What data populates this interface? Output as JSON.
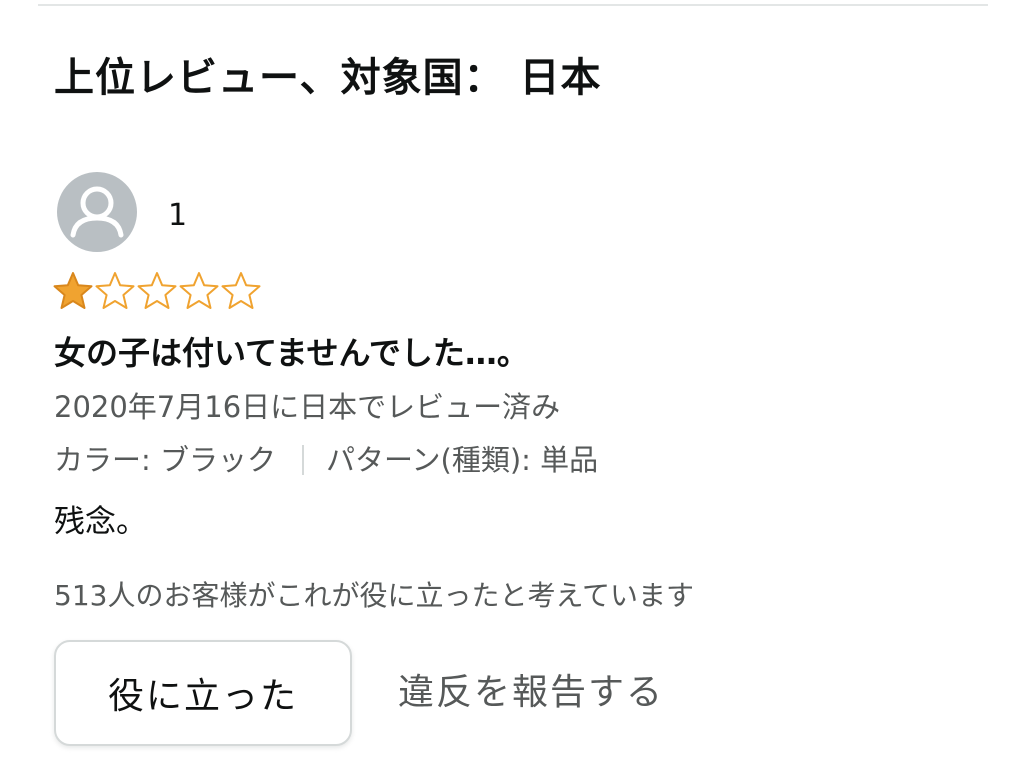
{
  "section": {
    "title": "上位レビュー、対象国： 日本"
  },
  "review": {
    "reviewer_name": "1",
    "avatar_icon": "user-silhouette-icon",
    "rating": 1,
    "rating_max": 5,
    "star_color": "#f0a330",
    "title": "女の子は付いてませんでした…。",
    "date_line": "2020年7月16日に日本でレビュー済み",
    "variant_color": "カラー: ブラック",
    "variant_pattern": "パターン(種類): 単品",
    "body": "残念。",
    "helpful_count_text": "513人のお客様がこれが役に立ったと考えています"
  },
  "actions": {
    "helpful_label": "役に立った",
    "report_label": "違反を報告する"
  }
}
